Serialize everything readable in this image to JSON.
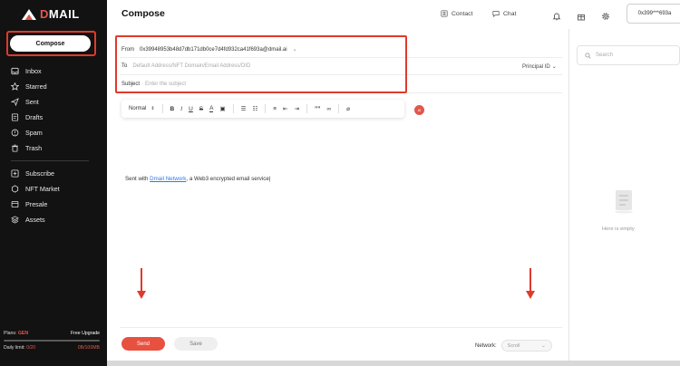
{
  "brand": {
    "name_accent": "D",
    "name_rest": "MAIL"
  },
  "sidebar": {
    "compose_label": "Compose",
    "primary_items": [
      {
        "label": "Inbox",
        "icon": "inbox-icon"
      },
      {
        "label": "Starred",
        "icon": "star-icon"
      },
      {
        "label": "Sent",
        "icon": "send-icon"
      },
      {
        "label": "Drafts",
        "icon": "draft-icon"
      },
      {
        "label": "Spam",
        "icon": "spam-icon"
      },
      {
        "label": "Trash",
        "icon": "trash-icon"
      }
    ],
    "secondary_items": [
      {
        "label": "Subscribe",
        "icon": "subscribe-icon"
      },
      {
        "label": "NFT Market",
        "icon": "nft-icon"
      },
      {
        "label": "Presale",
        "icon": "presale-icon"
      },
      {
        "label": "Assets",
        "icon": "assets-icon"
      }
    ],
    "plans": {
      "label": "Plans:",
      "plan": "GEN",
      "upgrade": "Free Upgrade",
      "daily_label": "Daily limit:",
      "daily_value": "0/20",
      "storage_value": "0B/100MB"
    }
  },
  "header": {
    "title": "Compose",
    "contact_label": "Contact",
    "chat_label": "Chat",
    "wallet": "0x399***693a"
  },
  "compose": {
    "from_label": "From",
    "from_value": "0x39948953b48d7db171db0ce7d4fd932ca41f693a@dmail.ai",
    "to_label": "To",
    "to_placeholder": "Default Address/NFT Domain/Email Address/DID",
    "subject_label": "Subject",
    "subject_placeholder": "Enter the subject",
    "principal_label": "Principal ID",
    "toolbar": {
      "format": "Normal",
      "bold": "B",
      "italic": "I",
      "underline": "U",
      "strike": "S",
      "color": "A",
      "quote": "””"
    },
    "ai_badge": "AI",
    "signature_prefix": "Sent with ",
    "signature_link": "Dmail Network",
    "signature_suffix": ", a Web3 encrypted email service",
    "send_label": "Send",
    "save_label": "Save",
    "network_label": "Network:",
    "network_value": "Scroll"
  },
  "right_panel": {
    "search_placeholder": "Search",
    "empty_text": "Here is empty"
  },
  "colors": {
    "accent": "#e8503f",
    "highlight": "#e03a2b",
    "sidebar_bg": "#121212",
    "link": "#2c7be5"
  }
}
